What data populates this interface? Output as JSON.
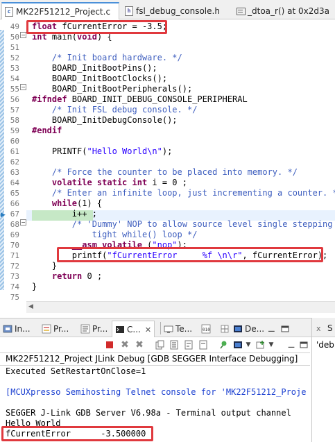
{
  "editor_tabs": [
    {
      "label": "MK22F51212_Project.c",
      "icon": "c-file-icon",
      "active": true
    },
    {
      "label": "fsl_debug_console.h",
      "icon": "h-file-icon",
      "active": false
    },
    {
      "label": "_dtoa_r() at 0x2d3a",
      "icon": "disassembly-icon",
      "active": false
    }
  ],
  "editor": {
    "line_numbers": [
      "49",
      "50",
      "51",
      "52",
      "53",
      "54",
      "55",
      "56",
      "57",
      "58",
      "59",
      "60",
      "61",
      "62",
      "63",
      "64",
      "65",
      "66",
      "67",
      "68",
      "69",
      "70",
      "71",
      "72",
      "73",
      "74",
      "75"
    ],
    "lines": [
      {
        "segments": [
          {
            "t": "float",
            "k": "kw"
          },
          {
            "t": " fCurrentError = -3.5;"
          }
        ]
      },
      {
        "segments": [
          {
            "t": "int",
            "k": "kw"
          },
          {
            "t": " main("
          },
          {
            "t": "void",
            "k": "kw"
          },
          {
            "t": ") {"
          }
        ]
      },
      {
        "segments": []
      },
      {
        "segments": [
          {
            "t": "    "
          },
          {
            "t": "/* Init board hardware. */",
            "k": "cm"
          }
        ]
      },
      {
        "segments": [
          {
            "t": "    BOARD_InitBootPins();"
          }
        ]
      },
      {
        "segments": [
          {
            "t": "    BOARD_InitBootClocks();"
          }
        ]
      },
      {
        "segments": [
          {
            "t": "    BOARD_InitBootPeripherals();"
          }
        ]
      },
      {
        "segments": [
          {
            "t": "#ifndef",
            "k": "kw"
          },
          {
            "t": " BOARD_INIT_DEBUG_CONSOLE_PERIPHERAL"
          }
        ]
      },
      {
        "segments": [
          {
            "t": "    "
          },
          {
            "t": "/* Init FSL debug console. */",
            "k": "cm"
          }
        ]
      },
      {
        "segments": [
          {
            "t": "    BOARD_InitDebugConsole();"
          }
        ]
      },
      {
        "segments": [
          {
            "t": "#endif",
            "k": "kw"
          }
        ]
      },
      {
        "segments": []
      },
      {
        "segments": [
          {
            "t": "    PRINTF("
          },
          {
            "t": "\"Hello World\\n\"",
            "k": "st"
          },
          {
            "t": ");"
          }
        ]
      },
      {
        "segments": []
      },
      {
        "segments": [
          {
            "t": "    "
          },
          {
            "t": "/* Force the counter to be placed into memory. */",
            "k": "cm"
          }
        ]
      },
      {
        "segments": [
          {
            "t": "    "
          },
          {
            "t": "volatile static int",
            "k": "kw"
          },
          {
            "t": " i = 0 ;"
          }
        ]
      },
      {
        "segments": [
          {
            "t": "    "
          },
          {
            "t": "/* Enter an infinite loop, just incrementing a counter. */",
            "k": "cm"
          }
        ]
      },
      {
        "segments": [
          {
            "t": "    "
          },
          {
            "t": "while",
            "k": "kw"
          },
          {
            "t": "(1) {"
          }
        ]
      },
      {
        "segments": [
          {
            "t": "        i++ ;"
          }
        ]
      },
      {
        "segments": [
          {
            "t": "        "
          },
          {
            "t": "/* 'Dummy' NOP to allow source level single stepping of",
            "k": "cm"
          }
        ]
      },
      {
        "segments": [
          {
            "t": "            "
          },
          {
            "t": "tight while() loop */",
            "k": "cm"
          }
        ]
      },
      {
        "segments": [
          {
            "t": "        "
          },
          {
            "t": "__asm volatile",
            "k": "kw"
          },
          {
            "t": " ("
          },
          {
            "t": "\"nop\"",
            "k": "st"
          },
          {
            "t": ");"
          }
        ]
      },
      {
        "segments": [
          {
            "t": "        printf("
          },
          {
            "t": "\"fCurrentError     %f \\n\\r\"",
            "k": "st"
          },
          {
            "t": ", fCurrentError);"
          }
        ]
      },
      {
        "segments": [
          {
            "t": "    }"
          }
        ]
      },
      {
        "segments": [
          {
            "t": "    "
          },
          {
            "t": "return",
            "k": "kw"
          },
          {
            "t": " 0 ;"
          }
        ]
      },
      {
        "segments": [
          {
            "t": "}"
          }
        ]
      },
      {
        "segments": []
      }
    ]
  },
  "view_tabs": [
    {
      "label": "In...",
      "icon": "installer-icon"
    },
    {
      "label": "Pr...",
      "icon": "problems-icon"
    },
    {
      "label": "Pr...",
      "icon": "properties-icon"
    },
    {
      "label": "C...",
      "icon": "console-icon"
    },
    {
      "label": "Te...",
      "icon": "terminal-icon"
    },
    {
      "label": "",
      "icon": "memory-icon"
    },
    {
      "label": "De...",
      "icon": "debugger-icon"
    }
  ],
  "right_pane": {
    "tab_label": "S",
    "content": "'deb"
  },
  "console": {
    "header": "MK22F51212_Project JLink Debug [GDB SEGGER Interface Debugging]",
    "lines": [
      {
        "text": "Executed SetRestartOnClose=1",
        "color": "#000000"
      },
      {
        "text": "",
        "color": "#000000"
      },
      {
        "text": "[MCUXpresso Semihosting Telnet console for 'MK22F51212_Proje",
        "color": "#1a3fd0"
      },
      {
        "text": "",
        "color": "#000000"
      },
      {
        "text": "SEGGER J-Link GDB Server V6.98a - Terminal output channel",
        "color": "#000000"
      },
      {
        "text": "Hello World",
        "color": "#000000"
      },
      {
        "text": "fCurrentError      -3.500000",
        "color": "#000000"
      }
    ]
  },
  "colors": {
    "highlight_box": "#e0393e",
    "keyword": "#7f0055",
    "comment": "#3f5fbf",
    "string": "#2a00ff"
  }
}
